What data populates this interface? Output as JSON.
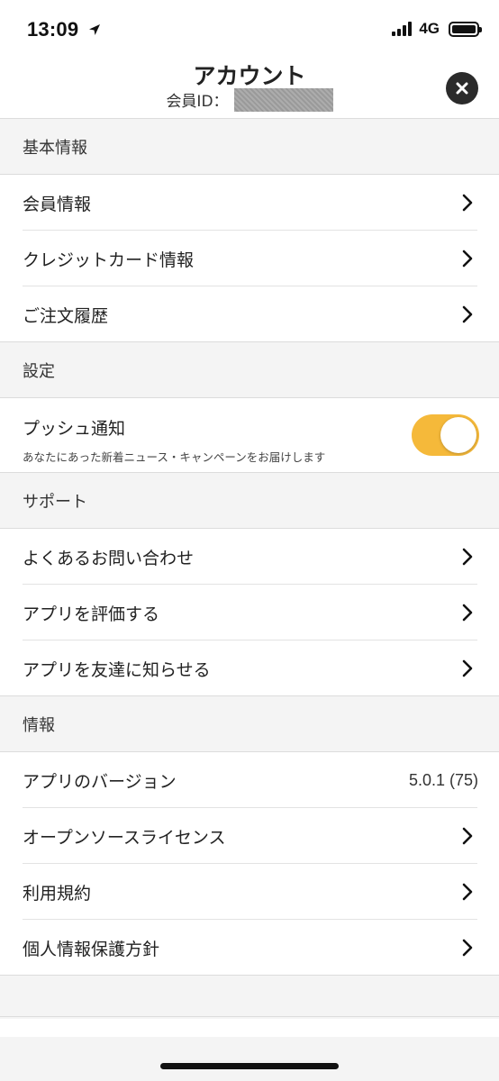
{
  "status_bar": {
    "time": "13:09",
    "network": "4G"
  },
  "header": {
    "title": "アカウント",
    "member_id_label": "会員ID："
  },
  "sections": {
    "basic": {
      "title": "基本情報",
      "member_info": "会員情報",
      "credit_card": "クレジットカード情報",
      "order_history": "ご注文履歴"
    },
    "settings": {
      "title": "設定",
      "push_title": "プッシュ通知",
      "push_desc": "あなたにあった新着ニュース・キャンペーンをお届けします",
      "push_enabled": true
    },
    "support": {
      "title": "サポート",
      "faq": "よくあるお問い合わせ",
      "rate_app": "アプリを評価する",
      "share_app": "アプリを友達に知らせる"
    },
    "info": {
      "title": "情報",
      "version_label": "アプリのバージョン",
      "version_value": "5.0.1 (75)",
      "open_source": "オープンソースライセンス",
      "terms": "利用規約",
      "privacy": "個人情報保護方針"
    }
  },
  "colors": {
    "toggle_on": "#f5b93a",
    "background": "#f4f4f4",
    "close_button": "#2b2b2b"
  },
  "icons": {
    "close": "close-icon",
    "chevron": "chevron-right-icon",
    "location": "location-arrow-icon"
  }
}
